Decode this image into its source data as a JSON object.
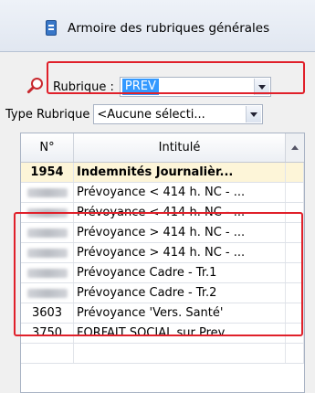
{
  "window": {
    "title": "Armoire des rubriques générales",
    "icon": "book-icon"
  },
  "filters": {
    "rubrique_label": "Rubrique :",
    "rubrique_value": "PREV",
    "type_label": "Type Rubrique",
    "type_value": "<Aucune sélecti..."
  },
  "grid": {
    "columns": [
      "N°",
      "Intitulé"
    ],
    "rows": [
      {
        "num": "1954",
        "label": "Indemnités Journalièr...",
        "selected": true
      },
      {
        "num": "",
        "label": "Prévoyance < 414 h. NC - ...",
        "masked": true
      },
      {
        "num": "",
        "label": "Prévoyance < 414 h. NC - ...",
        "masked": true
      },
      {
        "num": "",
        "label": "Prévoyance > 414 h. NC - ...",
        "masked": true
      },
      {
        "num": "",
        "label": "Prévoyance > 414 h. NC - ...",
        "masked": true
      },
      {
        "num": "",
        "label": "Prévoyance Cadre - Tr.1",
        "masked": true
      },
      {
        "num": "",
        "label": "Prévoyance Cadre - Tr.2",
        "masked": true
      },
      {
        "num": "3603",
        "label": "Prévoyance 'Vers. Santé'"
      },
      {
        "num": "3750",
        "label": "FORFAIT SOCIAL sur Prev..."
      },
      {
        "num": "",
        "label": ""
      }
    ]
  },
  "colors": {
    "highlight": "#e0202a",
    "selection": "#3399ff",
    "selected_row": "#fdf5d8"
  }
}
